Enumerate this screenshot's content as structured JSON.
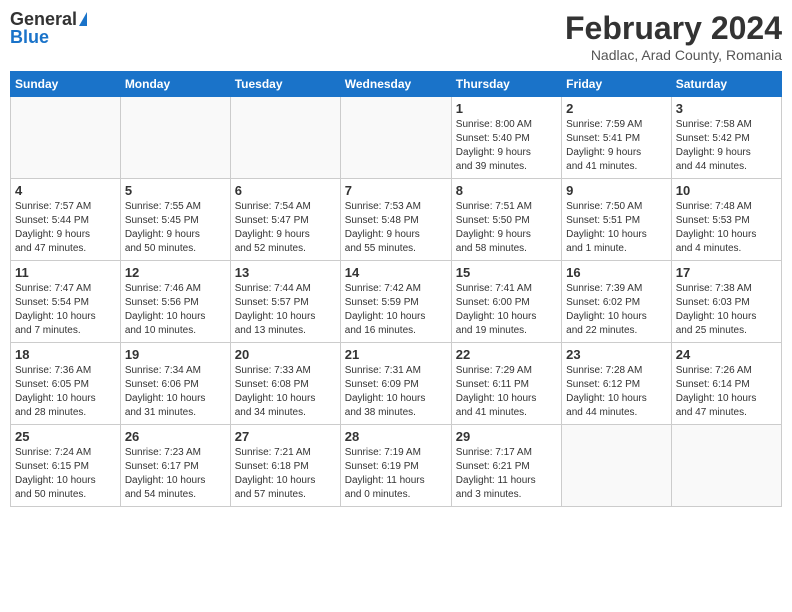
{
  "logo": {
    "general": "General",
    "blue": "Blue"
  },
  "header": {
    "month": "February 2024",
    "location": "Nadlac, Arad County, Romania"
  },
  "days_of_week": [
    "Sunday",
    "Monday",
    "Tuesday",
    "Wednesday",
    "Thursday",
    "Friday",
    "Saturday"
  ],
  "weeks": [
    [
      {
        "day": "",
        "info": ""
      },
      {
        "day": "",
        "info": ""
      },
      {
        "day": "",
        "info": ""
      },
      {
        "day": "",
        "info": ""
      },
      {
        "day": "1",
        "info": "Sunrise: 8:00 AM\nSunset: 5:40 PM\nDaylight: 9 hours\nand 39 minutes."
      },
      {
        "day": "2",
        "info": "Sunrise: 7:59 AM\nSunset: 5:41 PM\nDaylight: 9 hours\nand 41 minutes."
      },
      {
        "day": "3",
        "info": "Sunrise: 7:58 AM\nSunset: 5:42 PM\nDaylight: 9 hours\nand 44 minutes."
      }
    ],
    [
      {
        "day": "4",
        "info": "Sunrise: 7:57 AM\nSunset: 5:44 PM\nDaylight: 9 hours\nand 47 minutes."
      },
      {
        "day": "5",
        "info": "Sunrise: 7:55 AM\nSunset: 5:45 PM\nDaylight: 9 hours\nand 50 minutes."
      },
      {
        "day": "6",
        "info": "Sunrise: 7:54 AM\nSunset: 5:47 PM\nDaylight: 9 hours\nand 52 minutes."
      },
      {
        "day": "7",
        "info": "Sunrise: 7:53 AM\nSunset: 5:48 PM\nDaylight: 9 hours\nand 55 minutes."
      },
      {
        "day": "8",
        "info": "Sunrise: 7:51 AM\nSunset: 5:50 PM\nDaylight: 9 hours\nand 58 minutes."
      },
      {
        "day": "9",
        "info": "Sunrise: 7:50 AM\nSunset: 5:51 PM\nDaylight: 10 hours\nand 1 minute."
      },
      {
        "day": "10",
        "info": "Sunrise: 7:48 AM\nSunset: 5:53 PM\nDaylight: 10 hours\nand 4 minutes."
      }
    ],
    [
      {
        "day": "11",
        "info": "Sunrise: 7:47 AM\nSunset: 5:54 PM\nDaylight: 10 hours\nand 7 minutes."
      },
      {
        "day": "12",
        "info": "Sunrise: 7:46 AM\nSunset: 5:56 PM\nDaylight: 10 hours\nand 10 minutes."
      },
      {
        "day": "13",
        "info": "Sunrise: 7:44 AM\nSunset: 5:57 PM\nDaylight: 10 hours\nand 13 minutes."
      },
      {
        "day": "14",
        "info": "Sunrise: 7:42 AM\nSunset: 5:59 PM\nDaylight: 10 hours\nand 16 minutes."
      },
      {
        "day": "15",
        "info": "Sunrise: 7:41 AM\nSunset: 6:00 PM\nDaylight: 10 hours\nand 19 minutes."
      },
      {
        "day": "16",
        "info": "Sunrise: 7:39 AM\nSunset: 6:02 PM\nDaylight: 10 hours\nand 22 minutes."
      },
      {
        "day": "17",
        "info": "Sunrise: 7:38 AM\nSunset: 6:03 PM\nDaylight: 10 hours\nand 25 minutes."
      }
    ],
    [
      {
        "day": "18",
        "info": "Sunrise: 7:36 AM\nSunset: 6:05 PM\nDaylight: 10 hours\nand 28 minutes."
      },
      {
        "day": "19",
        "info": "Sunrise: 7:34 AM\nSunset: 6:06 PM\nDaylight: 10 hours\nand 31 minutes."
      },
      {
        "day": "20",
        "info": "Sunrise: 7:33 AM\nSunset: 6:08 PM\nDaylight: 10 hours\nand 34 minutes."
      },
      {
        "day": "21",
        "info": "Sunrise: 7:31 AM\nSunset: 6:09 PM\nDaylight: 10 hours\nand 38 minutes."
      },
      {
        "day": "22",
        "info": "Sunrise: 7:29 AM\nSunset: 6:11 PM\nDaylight: 10 hours\nand 41 minutes."
      },
      {
        "day": "23",
        "info": "Sunrise: 7:28 AM\nSunset: 6:12 PM\nDaylight: 10 hours\nand 44 minutes."
      },
      {
        "day": "24",
        "info": "Sunrise: 7:26 AM\nSunset: 6:14 PM\nDaylight: 10 hours\nand 47 minutes."
      }
    ],
    [
      {
        "day": "25",
        "info": "Sunrise: 7:24 AM\nSunset: 6:15 PM\nDaylight: 10 hours\nand 50 minutes."
      },
      {
        "day": "26",
        "info": "Sunrise: 7:23 AM\nSunset: 6:17 PM\nDaylight: 10 hours\nand 54 minutes."
      },
      {
        "day": "27",
        "info": "Sunrise: 7:21 AM\nSunset: 6:18 PM\nDaylight: 10 hours\nand 57 minutes."
      },
      {
        "day": "28",
        "info": "Sunrise: 7:19 AM\nSunset: 6:19 PM\nDaylight: 11 hours\nand 0 minutes."
      },
      {
        "day": "29",
        "info": "Sunrise: 7:17 AM\nSunset: 6:21 PM\nDaylight: 11 hours\nand 3 minutes."
      },
      {
        "day": "",
        "info": ""
      },
      {
        "day": "",
        "info": ""
      }
    ]
  ]
}
